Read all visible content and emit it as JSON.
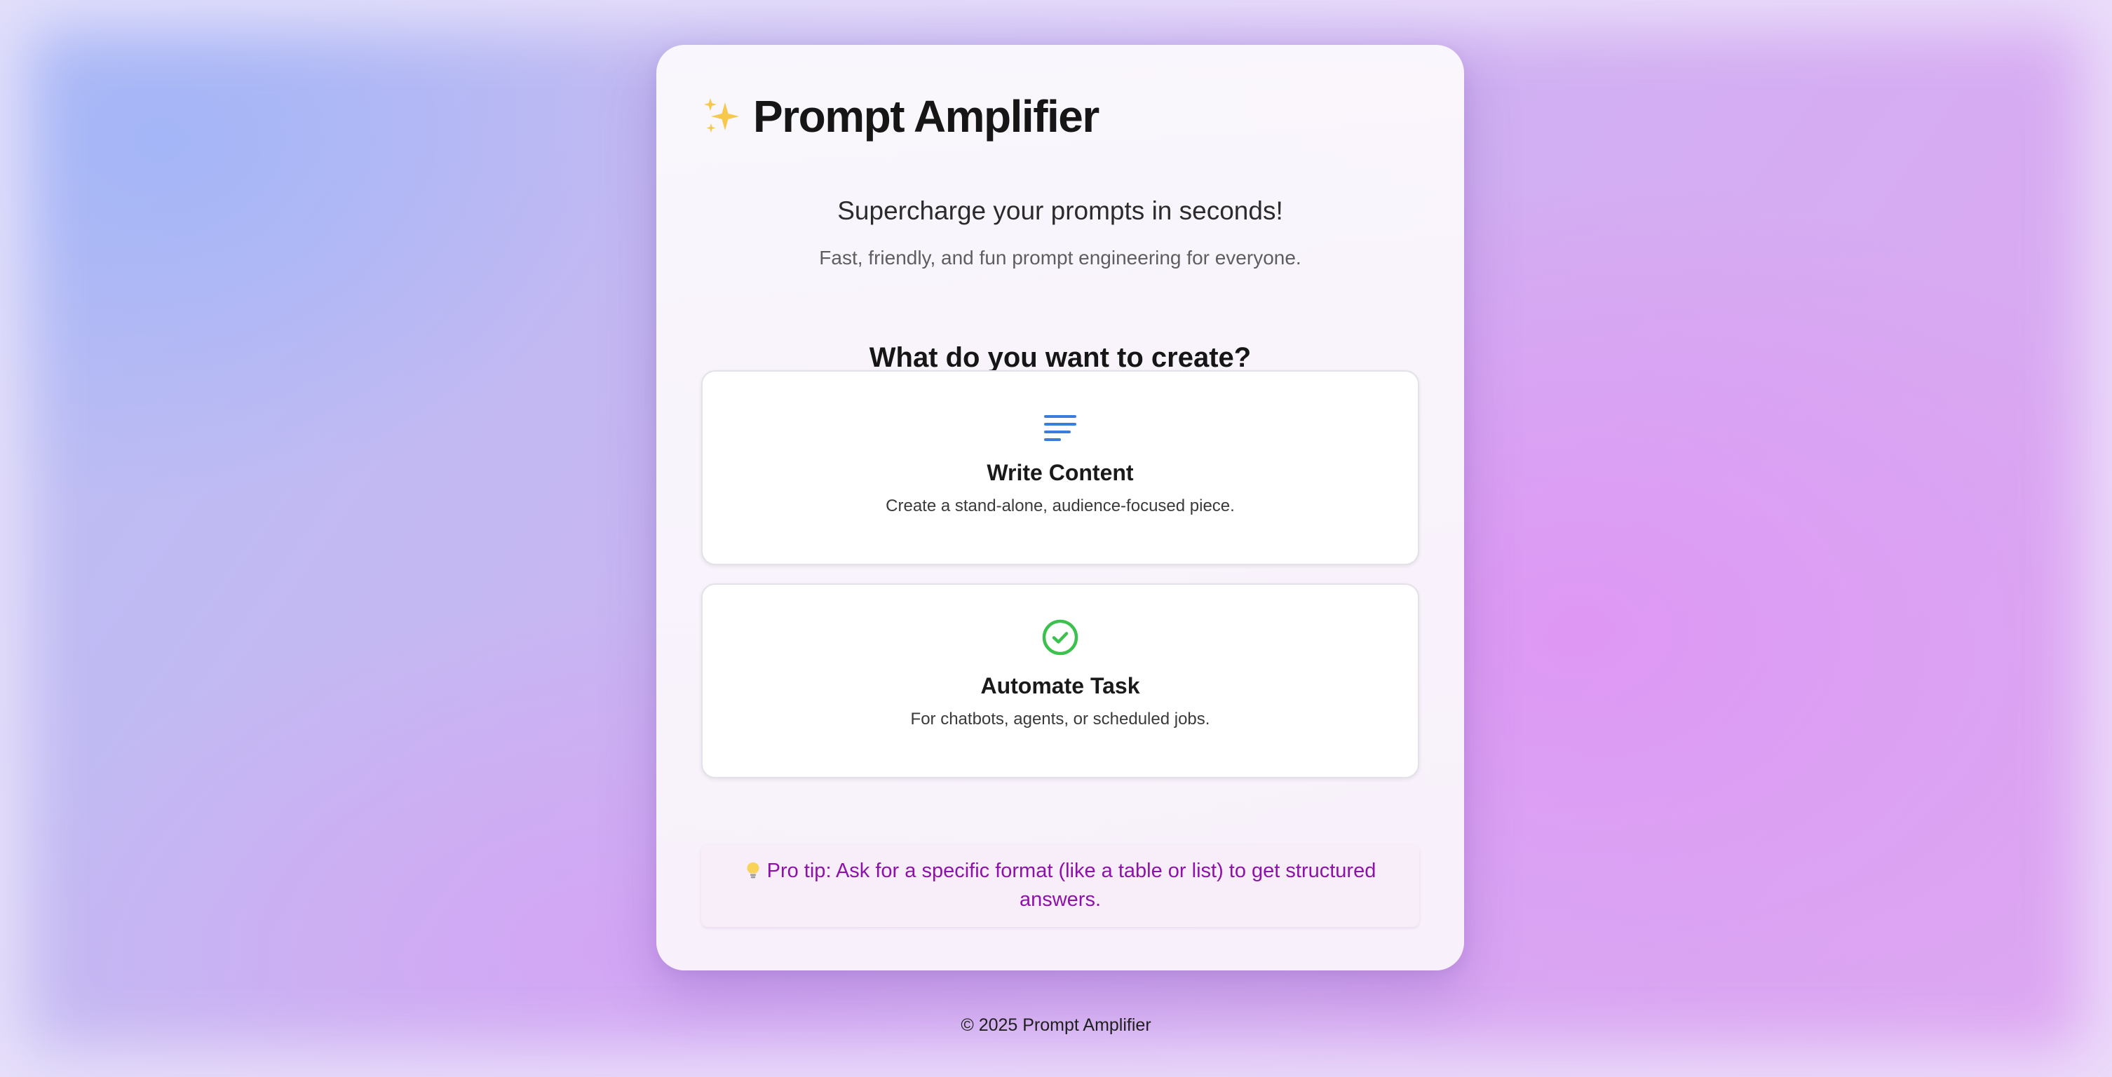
{
  "header": {
    "title": "Prompt Amplifier",
    "title_icon": "sparkles-icon",
    "subtitle": "Supercharge your prompts in seconds!",
    "tagline": "Fast, friendly, and fun prompt engineering for everyone."
  },
  "main": {
    "question": "What do you want to create?",
    "options": [
      {
        "icon": "text-lines-icon",
        "icon_color": "#3b7ddd",
        "title": "Write Content",
        "description": "Create a stand-alone, audience-focused piece."
      },
      {
        "icon": "check-circle-icon",
        "icon_color": "#3cc14e",
        "title": "Automate Task",
        "description": "For chatbots, agents, or scheduled jobs."
      }
    ]
  },
  "tip": {
    "icon": "lightbulb-icon",
    "text": "Pro tip: Ask for a specific format (like a table or list) to get structured answers.",
    "color": "#8d12a8"
  },
  "footer": {
    "text": "© 2025 Prompt Amplifier"
  },
  "colors": {
    "background_start": "#b7bff4",
    "background_end": "#dea4f2",
    "card": "#fbf8fd"
  }
}
